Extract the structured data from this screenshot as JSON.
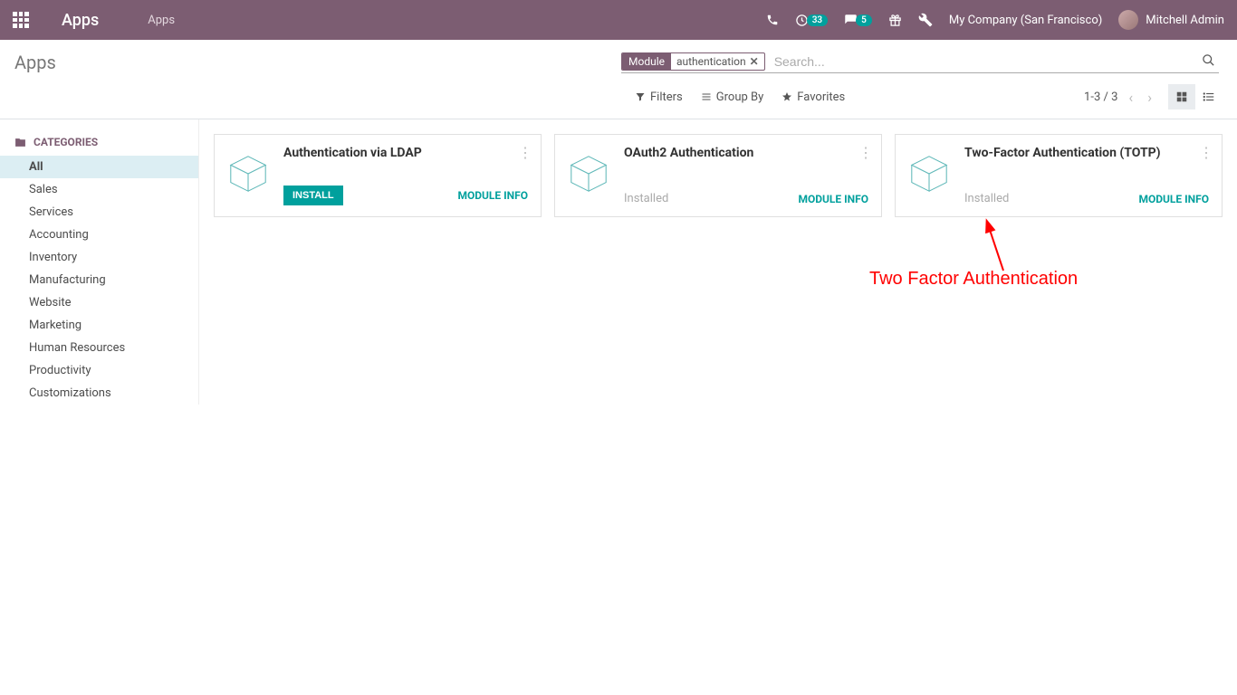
{
  "topbar": {
    "brand": "Apps",
    "breadcrumb": "Apps",
    "company": "My Company (San Francisco)",
    "user": "Mitchell Admin",
    "activity_count": "33",
    "message_count": "5"
  },
  "controlpanel": {
    "title": "Apps",
    "facet_label": "Module",
    "facet_value": "authentication",
    "search_placeholder": "Search...",
    "filters_label": "Filters",
    "groupby_label": "Group By",
    "favorites_label": "Favorites",
    "pager_text": "1-3 / 3"
  },
  "sidebar": {
    "header": "CATEGORIES",
    "items": [
      "All",
      "Sales",
      "Services",
      "Accounting",
      "Inventory",
      "Manufacturing",
      "Website",
      "Marketing",
      "Human Resources",
      "Productivity",
      "Customizations"
    ],
    "active_index": 0
  },
  "cards": [
    {
      "title": "Authentication via LDAP",
      "state": "install",
      "install_label": "INSTALL",
      "module_info": "MODULE INFO"
    },
    {
      "title": "OAuth2 Authentication",
      "state": "installed",
      "installed_label": "Installed",
      "module_info": "MODULE INFO"
    },
    {
      "title": "Two-Factor Authentication (TOTP)",
      "state": "installed",
      "installed_label": "Installed",
      "module_info": "MODULE INFO"
    }
  ],
  "annotation": {
    "label": "Two Factor Authentication"
  }
}
